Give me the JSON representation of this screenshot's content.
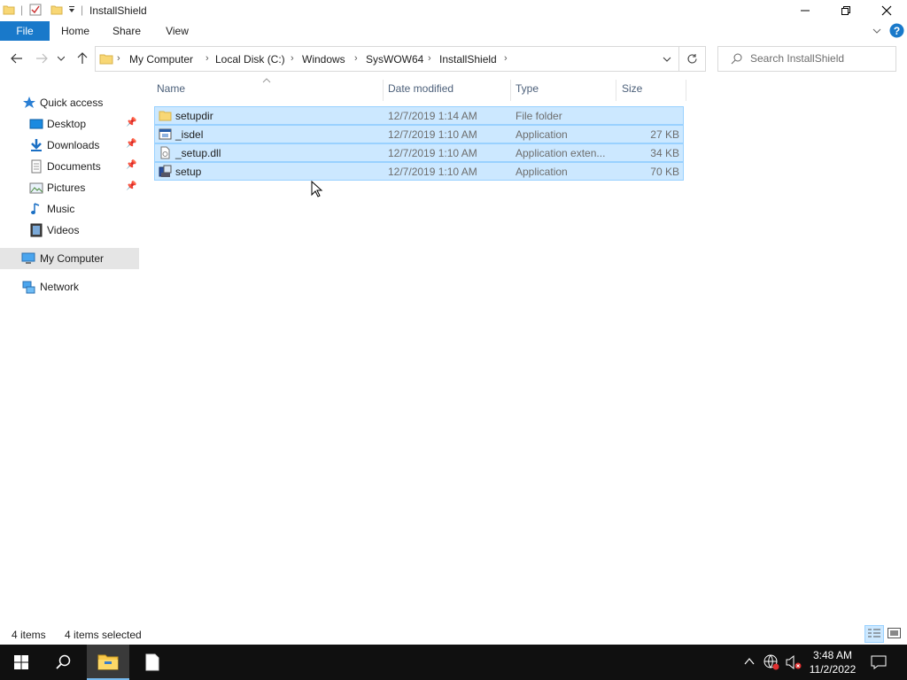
{
  "window": {
    "title": "InstallShield"
  },
  "ribbon": {
    "tabs": [
      "File",
      "Home",
      "Share",
      "View"
    ]
  },
  "address": {
    "crumbs": [
      "My Computer",
      "Local Disk (C:)",
      "Windows",
      "SysWOW64",
      "InstallShield"
    ],
    "search_placeholder": "Search InstallShield"
  },
  "sidebar": {
    "quick_access": "Quick access",
    "quick_items": [
      "Desktop",
      "Downloads",
      "Documents",
      "Pictures",
      "Music",
      "Videos"
    ],
    "my_computer": "My Computer",
    "network": "Network"
  },
  "columns": {
    "name": "Name",
    "date": "Date modified",
    "type": "Type",
    "size": "Size"
  },
  "files": [
    {
      "name": "setupdir",
      "date": "12/7/2019 1:14 AM",
      "type": "File folder",
      "size": ""
    },
    {
      "name": "_isdel",
      "date": "12/7/2019 1:10 AM",
      "type": "Application",
      "size": "27 KB"
    },
    {
      "name": "_setup.dll",
      "date": "12/7/2019 1:10 AM",
      "type": "Application exten...",
      "size": "34 KB"
    },
    {
      "name": "setup",
      "date": "12/7/2019 1:10 AM",
      "type": "Application",
      "size": "70 KB"
    }
  ],
  "status": {
    "count": "4 items",
    "selected": "4 items selected"
  },
  "taskbar": {
    "time": "3:48 AM",
    "date": "11/2/2022"
  },
  "colors": {
    "accent": "#1979ca",
    "selection": "#cce8ff",
    "selection_border": "#99d1ff"
  }
}
